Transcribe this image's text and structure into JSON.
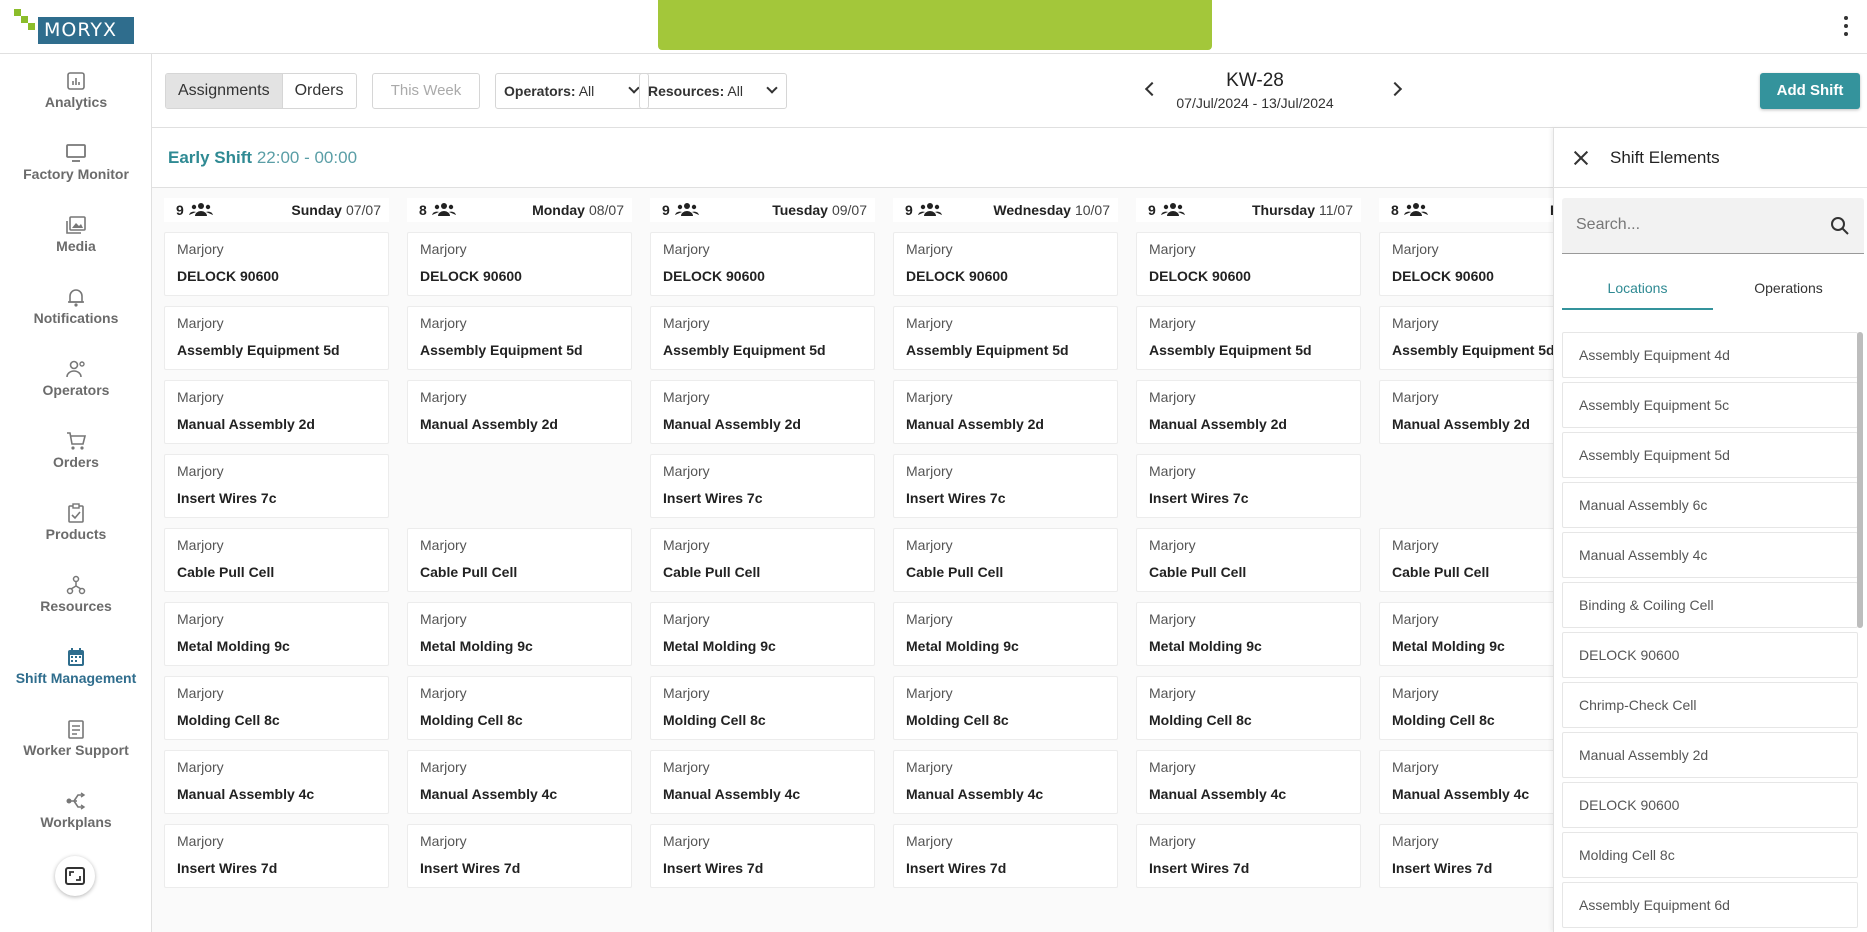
{
  "header": {
    "logo_text": "MORYX"
  },
  "sidebar": {
    "items": [
      {
        "label": "Analytics",
        "icon": "analytics-icon"
      },
      {
        "label": "Factory Monitor",
        "icon": "monitor-icon"
      },
      {
        "label": "Media",
        "icon": "media-icon"
      },
      {
        "label": "Notifications",
        "icon": "bell-icon"
      },
      {
        "label": "Operators",
        "icon": "operators-icon"
      },
      {
        "label": "Orders",
        "icon": "cart-icon"
      },
      {
        "label": "Products",
        "icon": "clipboard-check-icon"
      },
      {
        "label": "Resources",
        "icon": "resources-icon"
      },
      {
        "label": "Shift Management",
        "icon": "calendar-icon",
        "active": true
      },
      {
        "label": "Worker Support",
        "icon": "worker-support-icon"
      },
      {
        "label": "Workplans",
        "icon": "workplans-icon"
      }
    ]
  },
  "toolbar": {
    "view_assignments": "Assignments",
    "view_orders": "Orders",
    "this_week": "This Week",
    "operators_label": "Operators:",
    "operators_value": "All",
    "resources_label": "Resources:",
    "resources_value": "All",
    "week": "KW-28",
    "range": "07/Jul/2024 - 13/Jul/2024",
    "add_shift": "Add Shift"
  },
  "shift": {
    "name": "Early Shift",
    "time": "22:00 - 00:00"
  },
  "days": [
    {
      "count": "9",
      "name": "Sunday",
      "date": "07/07",
      "cards": [
        {
          "person": "Marjory",
          "location": "DELOCK 90600"
        },
        {
          "person": "Marjory",
          "location": "Assembly Equipment 5d"
        },
        {
          "person": "Marjory",
          "location": "Manual Assembly 2d"
        },
        {
          "person": "Marjory",
          "location": "Insert Wires 7c"
        },
        {
          "person": "Marjory",
          "location": "Cable Pull Cell"
        },
        {
          "person": "Marjory",
          "location": "Metal Molding 9c"
        },
        {
          "person": "Marjory",
          "location": "Molding Cell 8c"
        },
        {
          "person": "Marjory",
          "location": "Manual Assembly 4c"
        },
        {
          "person": "Marjory",
          "location": "Insert Wires 7d"
        }
      ]
    },
    {
      "count": "8",
      "name": "Monday",
      "date": "08/07",
      "cards": [
        {
          "person": "Marjory",
          "location": "DELOCK 90600"
        },
        {
          "person": "Marjory",
          "location": "Assembly Equipment 5d"
        },
        {
          "person": "Marjory",
          "location": "Manual Assembly 2d"
        },
        null,
        {
          "person": "Marjory",
          "location": "Cable Pull Cell"
        },
        {
          "person": "Marjory",
          "location": "Metal Molding 9c"
        },
        {
          "person": "Marjory",
          "location": "Molding Cell 8c"
        },
        {
          "person": "Marjory",
          "location": "Manual Assembly 4c"
        },
        {
          "person": "Marjory",
          "location": "Insert Wires 7d"
        }
      ]
    },
    {
      "count": "9",
      "name": "Tuesday",
      "date": "09/07",
      "cards": [
        {
          "person": "Marjory",
          "location": "DELOCK 90600"
        },
        {
          "person": "Marjory",
          "location": "Assembly Equipment 5d"
        },
        {
          "person": "Marjory",
          "location": "Manual Assembly 2d"
        },
        {
          "person": "Marjory",
          "location": "Insert Wires 7c"
        },
        {
          "person": "Marjory",
          "location": "Cable Pull Cell"
        },
        {
          "person": "Marjory",
          "location": "Metal Molding 9c"
        },
        {
          "person": "Marjory",
          "location": "Molding Cell 8c"
        },
        {
          "person": "Marjory",
          "location": "Manual Assembly 4c"
        },
        {
          "person": "Marjory",
          "location": "Insert Wires 7d"
        }
      ]
    },
    {
      "count": "9",
      "name": "Wednesday",
      "date": "10/07",
      "cards": [
        {
          "person": "Marjory",
          "location": "DELOCK 90600"
        },
        {
          "person": "Marjory",
          "location": "Assembly Equipment 5d"
        },
        {
          "person": "Marjory",
          "location": "Manual Assembly 2d"
        },
        {
          "person": "Marjory",
          "location": "Insert Wires 7c"
        },
        {
          "person": "Marjory",
          "location": "Cable Pull Cell"
        },
        {
          "person": "Marjory",
          "location": "Metal Molding 9c"
        },
        {
          "person": "Marjory",
          "location": "Molding Cell 8c"
        },
        {
          "person": "Marjory",
          "location": "Manual Assembly 4c"
        },
        {
          "person": "Marjory",
          "location": "Insert Wires 7d"
        }
      ]
    },
    {
      "count": "9",
      "name": "Thursday",
      "date": "11/07",
      "cards": [
        {
          "person": "Marjory",
          "location": "DELOCK 90600"
        },
        {
          "person": "Marjory",
          "location": "Assembly Equipment 5d"
        },
        {
          "person": "Marjory",
          "location": "Manual Assembly 2d"
        },
        {
          "person": "Marjory",
          "location": "Insert Wires 7c"
        },
        {
          "person": "Marjory",
          "location": "Cable Pull Cell"
        },
        {
          "person": "Marjory",
          "location": "Metal Molding 9c"
        },
        {
          "person": "Marjory",
          "location": "Molding Cell 8c"
        },
        {
          "person": "Marjory",
          "location": "Manual Assembly 4c"
        },
        {
          "person": "Marjory",
          "location": "Insert Wires 7d"
        }
      ]
    },
    {
      "count": "8",
      "name": "Friday",
      "date": "",
      "cards": [
        {
          "person": "Marjory",
          "location": "DELOCK 90600"
        },
        {
          "person": "Marjory",
          "location": "Assembly Equipment 5d"
        },
        {
          "person": "Marjory",
          "location": "Manual Assembly 2d"
        },
        null,
        {
          "person": "Marjory",
          "location": "Cable Pull Cell"
        },
        {
          "person": "Marjory",
          "location": "Metal Molding 9c"
        },
        {
          "person": "Marjory",
          "location": "Molding Cell 8c"
        },
        {
          "person": "Marjory",
          "location": "Manual Assembly 4c"
        },
        {
          "person": "Marjory",
          "location": "Insert Wires 7d"
        }
      ]
    }
  ],
  "panel": {
    "title": "Shift Elements",
    "search_placeholder": "Search...",
    "tab_locations": "Locations",
    "tab_operations": "Operations",
    "locations": [
      "Assembly Equipment 4d",
      "Assembly Equipment 5c",
      "Assembly Equipment 5d",
      "Manual Assembly 6c",
      "Manual Assembly 4c",
      "Binding & Coiling Cell",
      "DELOCK 90600",
      "Chrimp-Check Cell",
      "Manual Assembly 2d",
      "DELOCK 90600",
      "Molding Cell 8c",
      "Assembly Equipment 6d"
    ]
  },
  "colors": {
    "accent": "#34939c",
    "brand": "#2f6d8d",
    "banner": "#a3c73a"
  }
}
